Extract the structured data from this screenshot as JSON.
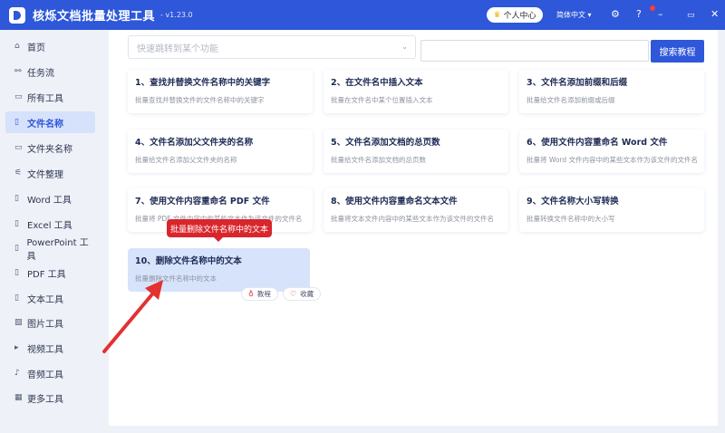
{
  "app": {
    "title": "核烁文档批量处理工具",
    "version": "- v1.23.0"
  },
  "header": {
    "user_center": "个人中心",
    "language": "简体中文",
    "lang_icon": "chevron-down-icon"
  },
  "sidebar": {
    "items": [
      {
        "label": "首页",
        "icon": "⌂"
      },
      {
        "label": "任务流",
        "icon": "⚯"
      },
      {
        "label": "所有工具",
        "icon": "▭"
      },
      {
        "label": "文件名称",
        "icon": "▯"
      },
      {
        "label": "文件夹名称",
        "icon": "▭"
      },
      {
        "label": "文件整理",
        "icon": "⚟"
      },
      {
        "label": "Word 工具",
        "icon": "▯"
      },
      {
        "label": "Excel 工具",
        "icon": "▯"
      },
      {
        "label": "PowerPoint 工具",
        "icon": "▯"
      },
      {
        "label": "PDF 工具",
        "icon": "▯"
      },
      {
        "label": "文本工具",
        "icon": "▯"
      },
      {
        "label": "图片工具",
        "icon": "▧"
      },
      {
        "label": "视频工具",
        "icon": "▸"
      },
      {
        "label": "音频工具",
        "icon": "♪"
      },
      {
        "label": "更多工具",
        "icon": "▦"
      }
    ],
    "active_index": 3
  },
  "search": {
    "placeholder": "快速跳转到某个功能",
    "button": "搜索教程"
  },
  "cards": [
    {
      "title": "1、查找并替换文件名称中的关键字",
      "desc": "批量查找并替换文件的文件名称中的关键字"
    },
    {
      "title": "2、在文件名中插入文本",
      "desc": "批量在文件名中某个位置插入文本"
    },
    {
      "title": "3、文件名添加前缀和后缀",
      "desc": "批量给文件名添加前缀或后缀"
    },
    {
      "title": "4、文件名添加父文件夹的名称",
      "desc": "批量给文件名添加父文件夹的名称"
    },
    {
      "title": "5、文件名添加文档的总页数",
      "desc": "批量给文件名添加文档的总页数"
    },
    {
      "title": "6、使用文件内容重命名 Word 文件",
      "desc": "批量将 Word 文件内容中的某些文本作为该文件的文件名"
    },
    {
      "title": "7、使用文件内容重命名 PDF 文件",
      "desc": "批量将 PDF 文件内容中的某些文本作为该文件的文件名"
    },
    {
      "title": "8、使用文件内容重命名文本文件",
      "desc": "批量将文本文件内容中的某些文本作为该文件的文件名"
    },
    {
      "title": "9、文件名称大小写转换",
      "desc": "批量转换文件名称中的大小写"
    },
    {
      "title": "10、删除文件名称中的文本",
      "desc": "批量删除文件名称中的文本"
    }
  ],
  "tooltip": "批量删除文件名称中的文本",
  "actions": {
    "tutorial": "教程",
    "favorite": "收藏"
  },
  "colors": {
    "accent": "#2e57d9",
    "tooltip": "#d9262c",
    "arrow": "#e23232"
  }
}
